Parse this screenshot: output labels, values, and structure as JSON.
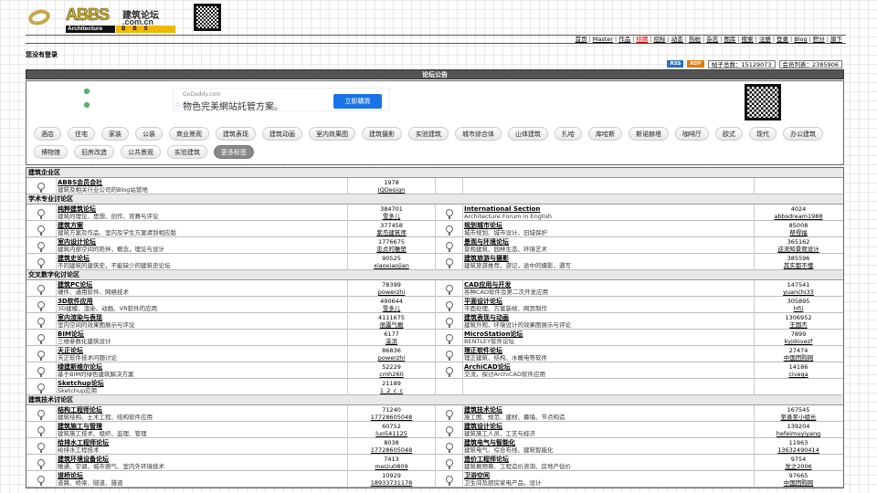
{
  "header": {
    "brand_big": "ABBS",
    "brand_cn": "建筑论坛",
    "brand_domain": ".com.cn",
    "brand_sub": "Architecture",
    "brand_sub2": "BBS"
  },
  "nav": [
    "首页",
    "Master",
    "作品",
    "招聘",
    "招标",
    "动态",
    "热帖",
    "杂志",
    "图库",
    "搜索",
    "注册",
    "登录",
    "Blog",
    "积分",
    "旗下"
  ],
  "status": {
    "not_logged": "您没有登录"
  },
  "stats": {
    "rss": "RSS",
    "rdf": "RDF",
    "posts": "帖子总数：15129073",
    "members": "会员列表：2385906"
  },
  "notice_title": "论坛公告",
  "ad": {
    "domain": "GoDaddy.com",
    "text": "物色完美網站託管方案。",
    "button": "立即購買"
  },
  "tags": [
    "酒店",
    "住宅",
    "家装",
    "公装",
    "商业景观",
    "建筑表现",
    "建筑动画",
    "室内效果图",
    "建筑摄影",
    "实验建筑",
    "城市综合体",
    "山体建筑",
    "扎哈",
    "库哈斯",
    "斯诺赫塔",
    "咖啡厅",
    "欧式",
    "现代",
    "办公建筑",
    "博物馆",
    "旧房改造",
    "公共景观",
    "实验建筑",
    "更多标签"
  ],
  "sections": [
    {
      "title": "建筑企业区",
      "rows": [
        {
          "l": {
            "name": "ABBS会员会社",
            "desc": "建筑及相关行业公司的Blog站营地",
            "count": "1978",
            "user": "IQDesign"
          },
          "r": null
        }
      ]
    },
    {
      "title": "学术专业讨论区",
      "rows": [
        {
          "l": {
            "name": "纯粹建筑论坛",
            "desc": "建筑的理论、思想、创作、竞赛与评论",
            "count": "384701",
            "user": "雪多儿"
          },
          "r": {
            "name": "International Section",
            "desc": "Architecture Forum in English",
            "count": "4024",
            "user": "abbsdream1988"
          }
        },
        {
          "l": {
            "name": "建筑方案",
            "desc": "建筑方案及作品、室内及学生方案请到相应版",
            "count": "377458",
            "user": "紫岛建筑师"
          },
          "r": {
            "name": "规划城市论坛",
            "desc": "城市规划、城市设计、旧城保护",
            "count": "85008",
            "user": "帮得福"
          }
        },
        {
          "l": {
            "name": "室内设计论坛",
            "desc": "建筑内部空间的陪伴，概念，理论与设计",
            "count": "1776675",
            "user": "忠贞的雕塑"
          },
          "r": {
            "name": "景观与环境论坛",
            "desc": "景观建筑、园林生态、环境艺术",
            "count": "365162",
            "user": "逆流知景观设计"
          }
        },
        {
          "l": {
            "name": "建筑史论坛",
            "desc": "不同建筑的建筑史，不能缺少的建筑史论坛",
            "count": "90525",
            "user": "xiaoxiaojian"
          },
          "r": {
            "name": "建筑旅游与摄影",
            "desc": "建筑旅游推荐，游记，途中的摄影，遇写",
            "count": "385596",
            "user": "其实都不懂"
          }
        }
      ]
    },
    {
      "title": "交叉数字化讨论区",
      "rows": [
        {
          "l": {
            "name": "建筑PC论坛",
            "desc": "硬件、通用软件、网络技术",
            "count": "78399",
            "user": "powerzhi"
          },
          "r": {
            "name": "CAD应用与开发",
            "desc": "各种CAD软件及第二次开发应用",
            "count": "147541",
            "user": "yuanchi33"
          }
        },
        {
          "l": {
            "name": "3D软件应用",
            "desc": "3D建模、渲染、动画、VR软件的应用",
            "count": "490644",
            "user": "雪多儿"
          },
          "r": {
            "name": "平面设计论坛",
            "desc": "平面处理、方案装帧、网页制作",
            "count": "305895",
            "user": "hfti"
          }
        },
        {
          "l": {
            "name": "室内渲染与表现",
            "desc": "室内空间的效果图展示与评论",
            "count": "4111675",
            "user": "很露气概"
          },
          "r": {
            "name": "建筑表现与动画",
            "desc": "建筑外观、环境设计的效果图展示与评论",
            "count": "1306952",
            "user": "王国杰"
          }
        },
        {
          "l": {
            "name": "BIM论坛",
            "desc": "三维参数化建筑设计",
            "count": "6177",
            "user": "溪滨"
          },
          "r": {
            "name": "MicroStation论坛",
            "desc": "BENTLEY软件论坛",
            "count": "7899",
            "user": "kyjdovezf"
          }
        },
        {
          "l": {
            "name": "天正论坛",
            "desc": "天正软件技术问题讨论",
            "count": "86836",
            "user": "powerzhi"
          },
          "r": {
            "name": "理正软件论坛",
            "desc": "理正建筑、结构、水暖电等软件",
            "count": "27474",
            "user": "中国团购网"
          }
        },
        {
          "l": {
            "name": "绿建斯维尔论坛",
            "desc": "基于BIM的绿色建筑解决方案",
            "count": "52229",
            "user": "cmh260"
          },
          "r": {
            "name": "ArchiCAD论坛",
            "desc": "交流，探讨ArchiCAD软件应用",
            "count": "14186",
            "user": "civega"
          }
        },
        {
          "l": {
            "name": "Sketchup论坛",
            "desc": "Sketchup应用",
            "count": "21189",
            "user": "1_2_c_c"
          },
          "r": null
        }
      ]
    },
    {
      "title": "建筑技术讨论区",
      "rows": [
        {
          "l": {
            "name": "结构工程师论坛",
            "desc": "建筑结构、土木工程、结构软件应用",
            "count": "71240",
            "user": "17728605048"
          },
          "r": {
            "name": "建筑技术论坛",
            "desc": "施工图、规范、建材、幕墙、节点构造",
            "count": "167545",
            "user": "至善至小组长"
          }
        },
        {
          "l": {
            "name": "建筑施工与管理",
            "desc": "建筑施工技术、组织、监理、管理",
            "count": "60752",
            "user": "luo541125"
          },
          "r": {
            "name": "建筑设计论坛",
            "desc": "建筑施工人员、工艺与经济",
            "count": "139204",
            "user": "hefeimuyiyang"
          }
        },
        {
          "l": {
            "name": "给排水工程师论坛",
            "desc": "给排水工程技术",
            "count": "8038",
            "user": "17728605048"
          },
          "r": {
            "name": "建筑电气与智能化",
            "desc": "建筑电气、综合布线、建筑智能化",
            "count": "11963",
            "user": "13632490414"
          }
        },
        {
          "l": {
            "name": "建筑环境设备论坛",
            "desc": "暖通、空调、城市燃气、室内外环境技术",
            "count": "7413",
            "user": "meizu0809"
          },
          "r": {
            "name": "造价工程师论坛",
            "desc": "建筑概预算、工程造价咨询、房地产估价",
            "count": "9754",
            "user": "龙之2006"
          }
        },
        {
          "l": {
            "name": "道桥论坛",
            "desc": "道路、桥梁、隧道、隧道",
            "count": "10929",
            "user": "18933731178"
          },
          "r": {
            "name": "卫浴空间",
            "desc": "卫生间及厨房家电产品，设计",
            "count": "97665",
            "user": "中国团购网"
          }
        }
      ]
    }
  ]
}
